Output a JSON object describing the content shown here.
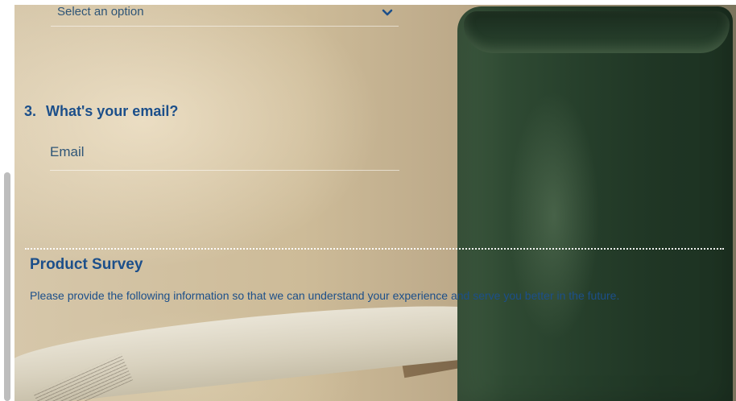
{
  "form": {
    "select": {
      "placeholder": "Select an option"
    },
    "question3": {
      "number": "3.",
      "label": "What's your email?",
      "email_placeholder": "Email"
    }
  },
  "survey": {
    "title": "Product Survey",
    "description": "Please provide the following information so that we can understand your experience and serve you better in the future."
  },
  "colors": {
    "accent": "#1c4f8a"
  },
  "icons": {
    "select_chevron": "chevron-down-icon"
  }
}
